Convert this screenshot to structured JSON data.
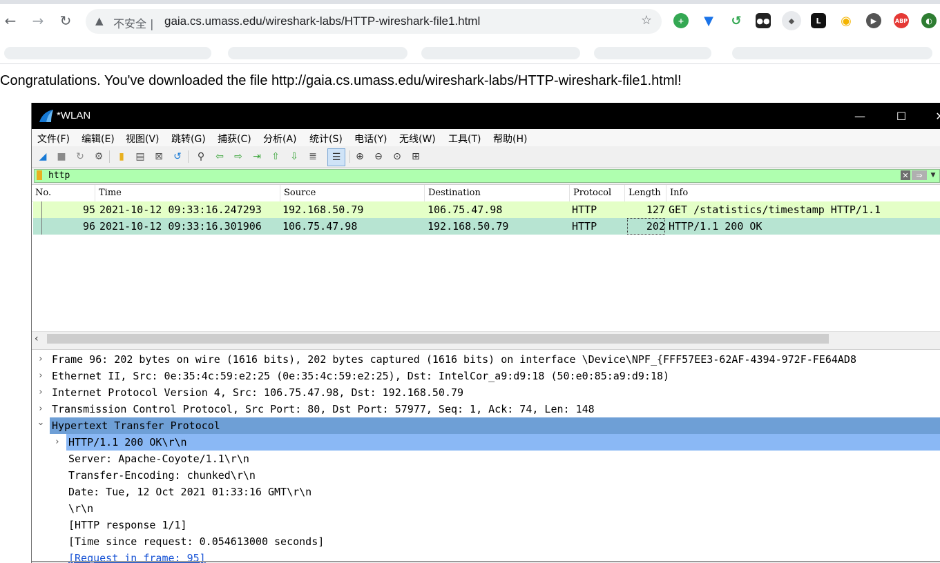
{
  "browser": {
    "insecure_label": "不安全",
    "url": "gaia.cs.umass.edu/wireshark-labs/HTTP-wireshark-file1.html"
  },
  "page": {
    "message": "Congratulations. You've downloaded the file http://gaia.cs.umass.edu/wireshark-labs/HTTP-wireshark-file1.html!"
  },
  "wireshark": {
    "title": "*WLAN",
    "menu": [
      "文件(F)",
      "编辑(E)",
      "视图(V)",
      "跳转(G)",
      "捕获(C)",
      "分析(A)",
      "统计(S)",
      "电话(Y)",
      "无线(W)",
      "工具(T)",
      "帮助(H)"
    ],
    "filter": {
      "value": "http",
      "color": "#afffaf"
    },
    "columns": [
      "No.",
      "Time",
      "Source",
      "Destination",
      "Protocol",
      "Length",
      "Info"
    ],
    "packets": [
      {
        "no": "95",
        "time": "2021-10-12 09:33:16.247293",
        "source": "192.168.50.79",
        "destination": "106.75.47.98",
        "protocol": "HTTP",
        "length": "127",
        "info": "GET /statistics/timestamp HTTP/1.1",
        "bg": "#e4ffc7"
      },
      {
        "no": "96",
        "time": "2021-10-12 09:33:16.301906",
        "source": "106.75.47.98",
        "destination": "192.168.50.79",
        "protocol": "HTTP",
        "length": "202",
        "info": "HTTP/1.1 200 OK",
        "bg": "#b7e4d2",
        "selected": true
      }
    ],
    "details": [
      {
        "text": "Frame 96: 202 bytes on wire (1616 bits), 202 bytes captured (1616 bits) on interface \\Device\\NPF_{FFF57EE3-62AF-4394-972F-FE64AD8",
        "arrow": "collapsed",
        "level": 0
      },
      {
        "text": "Ethernet II, Src: 0e:35:4c:59:e2:25 (0e:35:4c:59:e2:25), Dst: IntelCor_a9:d9:18 (50:e0:85:a9:d9:18)",
        "arrow": "collapsed",
        "level": 0
      },
      {
        "text": "Internet Protocol Version 4, Src: 106.75.47.98, Dst: 192.168.50.79",
        "arrow": "collapsed",
        "level": 0
      },
      {
        "text": "Transmission Control Protocol, Src Port: 80, Dst Port: 57977, Seq: 1, Ack: 74, Len: 148",
        "arrow": "collapsed",
        "level": 0
      },
      {
        "text": "Hypertext Transfer Protocol",
        "arrow": "expanded",
        "level": 0,
        "highlight": "#6e9fd6"
      },
      {
        "text": "HTTP/1.1 200 OK\\r\\n",
        "arrow": "collapsed",
        "level": 1,
        "highlight": "#8ab8f5"
      },
      {
        "text": "Server: Apache-Coyote/1.1\\r\\n",
        "arrow": "none",
        "level": 1
      },
      {
        "text": "Transfer-Encoding: chunked\\r\\n",
        "arrow": "none",
        "level": 1
      },
      {
        "text": "Date: Tue, 12 Oct 2021 01:33:16 GMT\\r\\n",
        "arrow": "none",
        "level": 1
      },
      {
        "text": "\\r\\n",
        "arrow": "none",
        "level": 1
      },
      {
        "text": "[HTTP response 1/1]",
        "arrow": "none",
        "level": 1
      },
      {
        "text": "[Time since request: 0.054613000 seconds]",
        "arrow": "none",
        "level": 1
      },
      {
        "text": "[Request in frame: 95]",
        "arrow": "none",
        "level": 1,
        "link": true
      }
    ]
  }
}
